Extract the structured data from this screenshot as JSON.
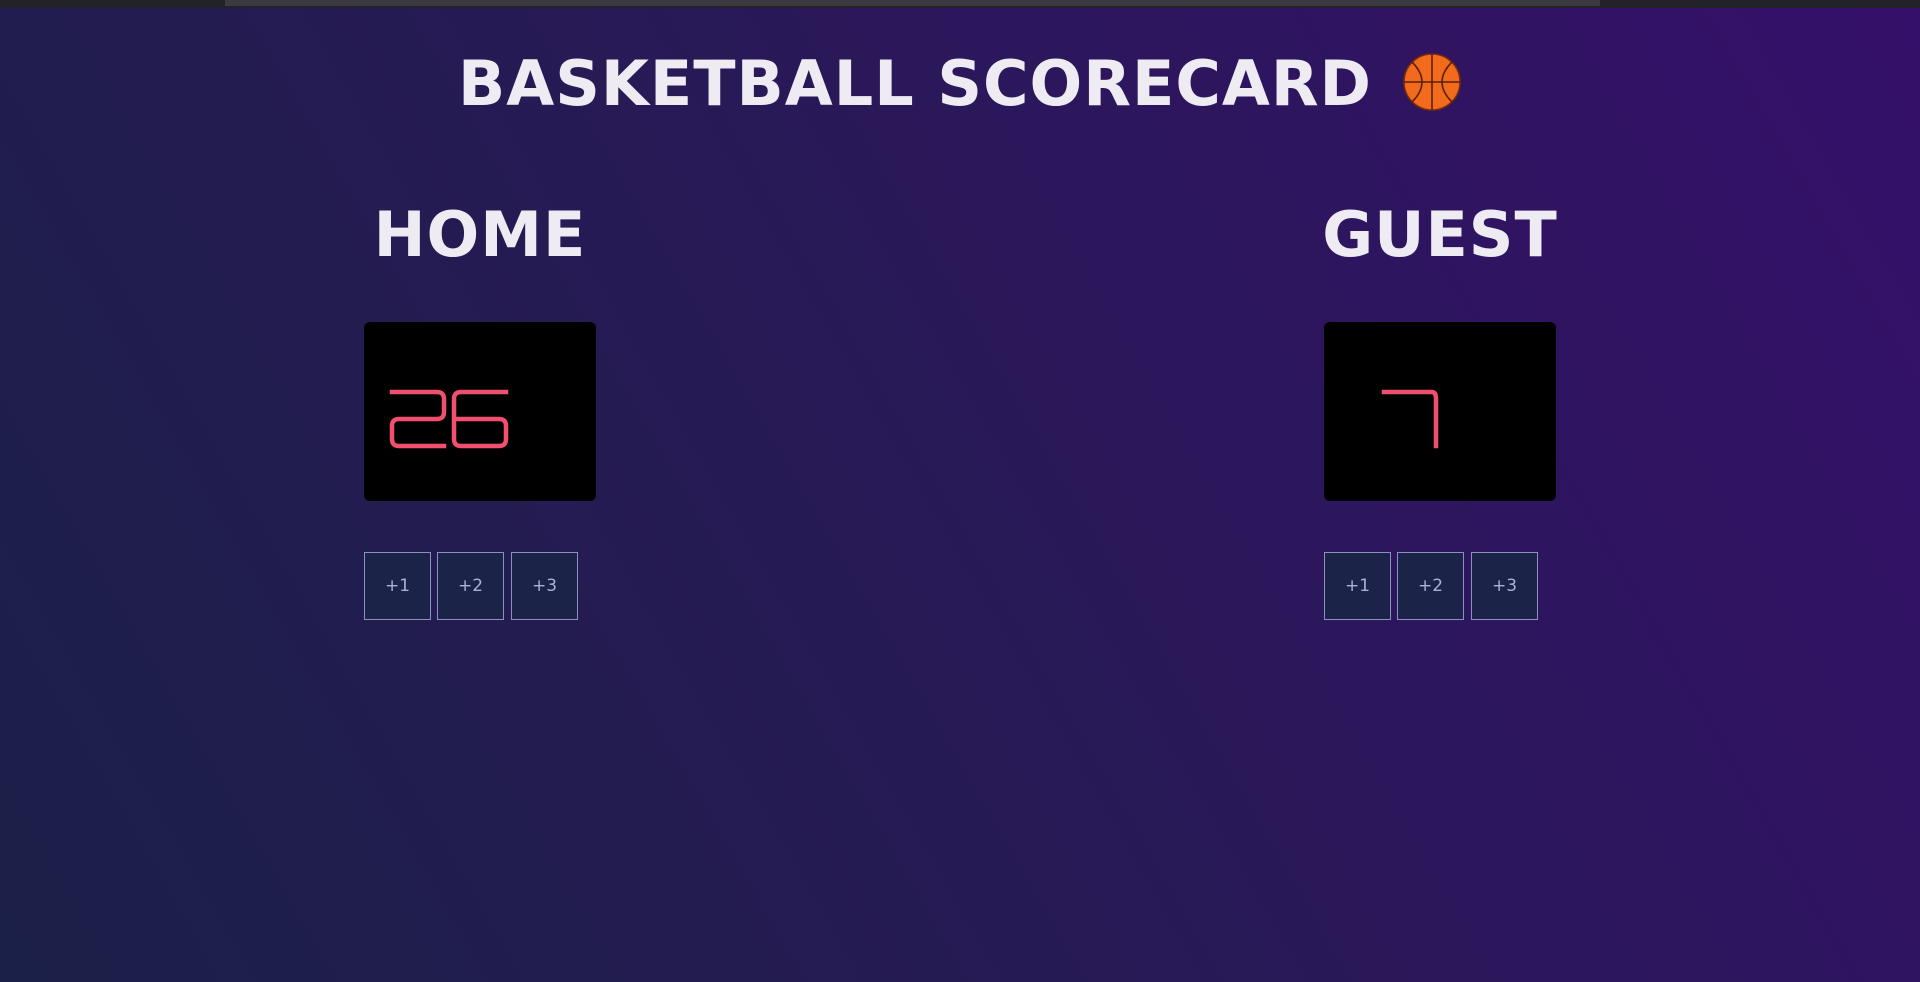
{
  "app": {
    "title": "BASKETBALL SCORECARD",
    "title_icon": "basketball-icon"
  },
  "home": {
    "name": "HOME",
    "score": "26",
    "buttons": [
      "+1",
      "+2",
      "+3"
    ]
  },
  "guest": {
    "name": "GUEST",
    "score": "7",
    "buttons": [
      "+1",
      "+2",
      "+3"
    ]
  },
  "colors": {
    "score_digits": "#f0506e",
    "score_background": "#000000",
    "title_text": "#eeebf2",
    "button_background": "#1c2348",
    "button_border": "#8b90bf",
    "ball": "#f26b1d"
  }
}
